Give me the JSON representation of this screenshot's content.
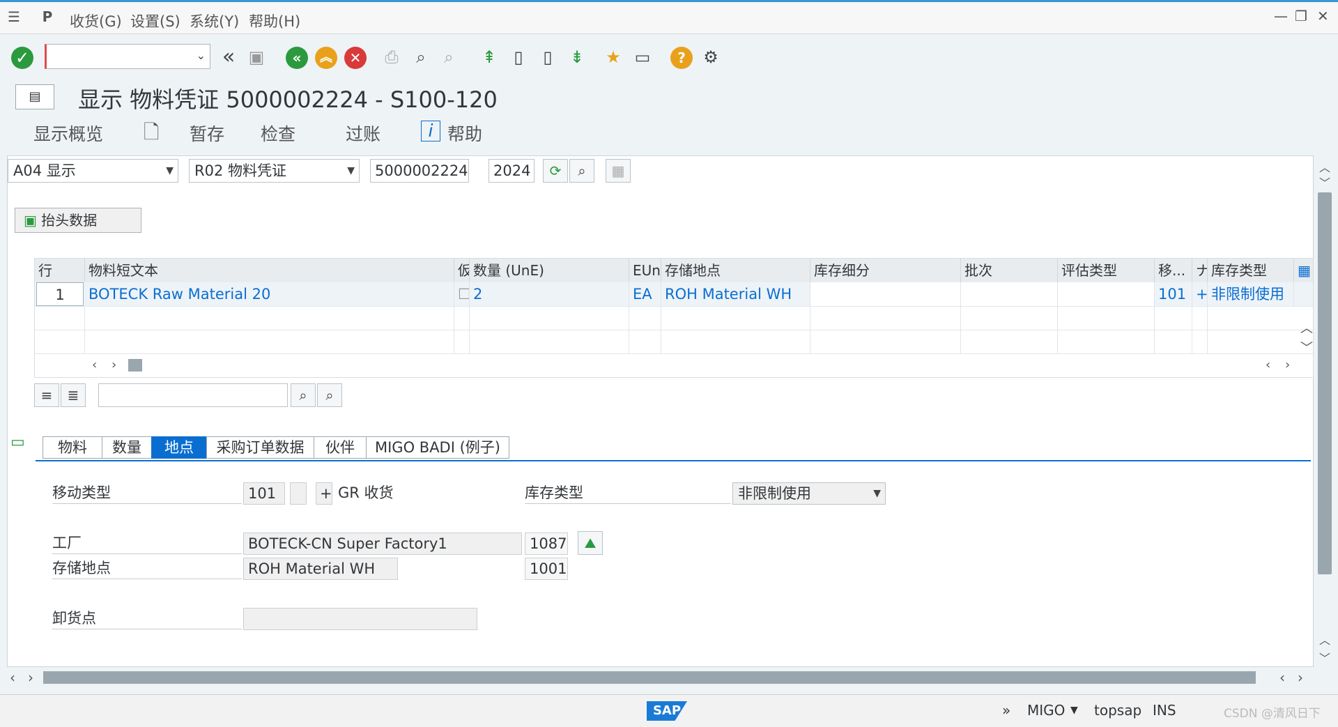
{
  "menu": {
    "items": [
      "收货(G)",
      "设置(S)",
      "系统(Y)",
      "帮助(H)"
    ]
  },
  "toolbar": {
    "command_value": ""
  },
  "title": {
    "text": "显示 物料凭证 5000002224 - S100-120"
  },
  "app_toolbar": {
    "overview": "显示概览",
    "hold": "暂存",
    "check": "检查",
    "post": "过账",
    "help": "帮助"
  },
  "header_fields": {
    "action": "A04 显示",
    "reference": "R02 物料凭证",
    "doc_number": "5000002224",
    "year": "2024"
  },
  "header_button": "抬头数据",
  "table": {
    "columns": [
      "行",
      "物料短文本",
      "仮",
      "数量 (UnE)",
      "EUn",
      "存储地点",
      "库存细分",
      "批次",
      "评估类型",
      "移...",
      "ナ",
      "库存类型"
    ],
    "rows": [
      {
        "line": "1",
        "material": "BOTECK Raw Material 20",
        "qty": "2",
        "unit": "EA",
        "sloc": "ROH Material WH",
        "movement": "101",
        "sign": "+",
        "stock_type": "非限制使用"
      }
    ]
  },
  "tabs": [
    "物料",
    "数量",
    "地点",
    "采购订单数据",
    "伙伴",
    "MIGO BADI (例子)"
  ],
  "active_tab": "地点",
  "detail": {
    "movement_label": "移动类型",
    "movement_value": "101",
    "movement_sign": "+",
    "movement_text": "GR 收货",
    "stock_type_label": "库存类型",
    "stock_type_value": "非限制使用",
    "plant_label": "工厂",
    "plant_name": "BOTECK-CN Super Factory1",
    "plant_code": "1087",
    "sloc_label": "存储地点",
    "sloc_name": "ROH Material WH",
    "sloc_code": "1001",
    "unloading_label": "卸货点",
    "unloading_value": ""
  },
  "status_bar": {
    "chevrons": "»",
    "tcode": "MIGO",
    "system": "topsap",
    "mode": "INS",
    "watermark": "CSDN @清风日下",
    "sap_logo": "SAP"
  },
  "colors": {
    "accent": "#0a6ed1",
    "topline": "#3b96d1",
    "green": "#2b9a3e",
    "orange": "#e9a11b",
    "red": "#d93a3a"
  }
}
